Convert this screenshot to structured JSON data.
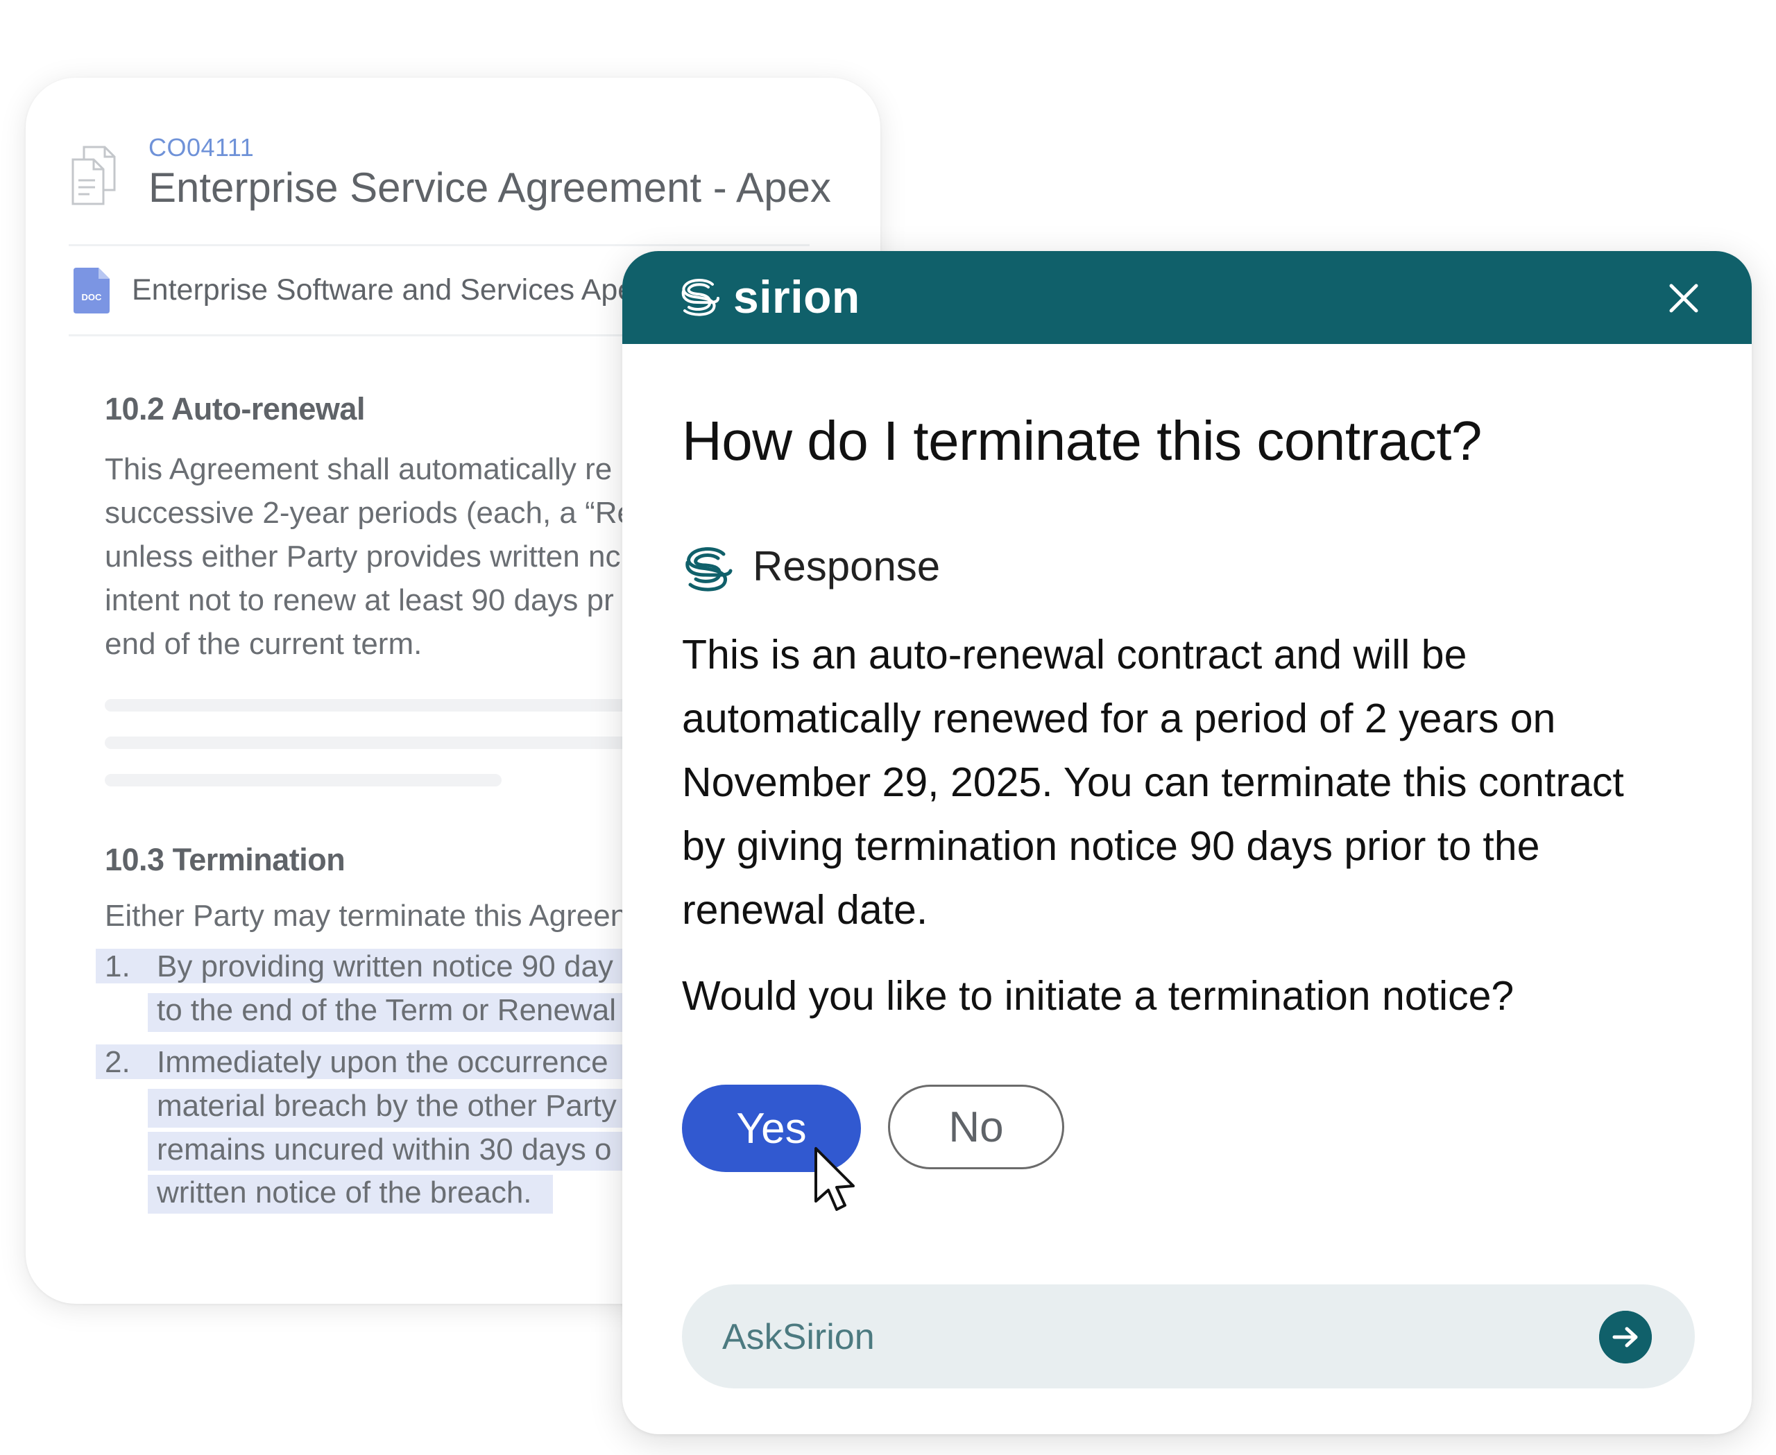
{
  "document": {
    "id": "CO04111",
    "title": "Enterprise Service Agreement - Apex",
    "file_icon_label": "DOC",
    "file_name": "Enterprise Software and Services Apex",
    "sections": [
      {
        "heading": "10.2 Auto-renewal",
        "lines": [
          "This Agreement shall automatically re",
          "successive 2-year periods (each, a “Re",
          "unless either Party provides written nc",
          "intent not to renew at least 90 days pr",
          "end of the current term."
        ]
      },
      {
        "heading": "10.3 Termination",
        "intro": "Either Party may terminate this Agreen",
        "list": [
          {
            "number": "1.",
            "lines": [
              "By providing written notice 90 day",
              "to the end of the Term or Renewal"
            ]
          },
          {
            "number": "2.",
            "lines": [
              "Immediately upon the occurrence",
              "material breach by the other Party",
              "remains uncured within 30 days o",
              "written notice of the breach."
            ]
          }
        ]
      }
    ]
  },
  "chat": {
    "brand": "sirion",
    "question": "How do I terminate this contract?",
    "response_label": "Response",
    "answer_lines": [
      "This is an auto-renewal contract and will be",
      "automatically renewed for a period of 2 years on",
      "November 29, 2025. You can terminate this contract",
      "by giving termination notice 90 days prior to the",
      "renewal date."
    ],
    "prompt": "Would you like to initiate a termination notice?",
    "yes_label": "Yes",
    "no_label": "No",
    "input_placeholder": "AskSirion",
    "colors": {
      "header": "#10606a",
      "yes_button": "#3159d0",
      "highlight": "#e3e8f7"
    }
  }
}
